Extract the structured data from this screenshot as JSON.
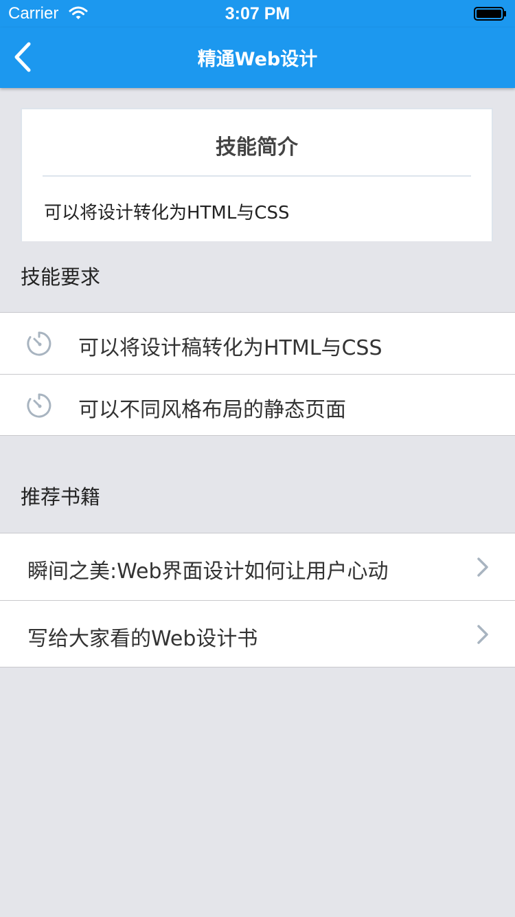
{
  "status": {
    "carrier": "Carrier",
    "time": "3:07 PM"
  },
  "nav": {
    "title": "精通Web设计",
    "back_icon": "chevron-left-icon"
  },
  "intro": {
    "title": "技能简介",
    "text": "可以将设计转化为HTML与CSS"
  },
  "requirements": {
    "heading": "技能要求",
    "icon": "timer-icon",
    "items": [
      {
        "label": "可以将设计稿转化为HTML与CSS"
      },
      {
        "label": "可以不同风格布局的静态页面"
      }
    ]
  },
  "books": {
    "heading": "推荐书籍",
    "items": [
      {
        "label": "瞬间之美:Web界面设计如何让用户心动"
      },
      {
        "label": "写给大家看的Web设计书"
      }
    ]
  },
  "colors": {
    "nav": "#1c98ef",
    "background": "#e4e5ea",
    "icon": "#a8b4c0"
  }
}
